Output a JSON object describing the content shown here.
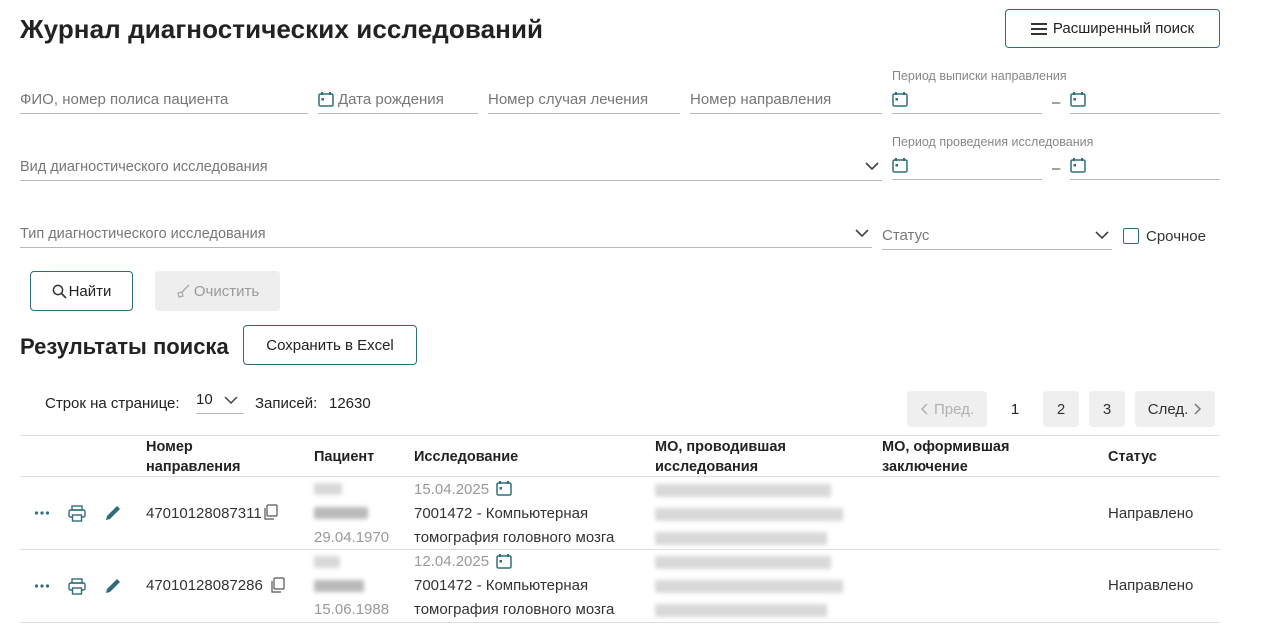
{
  "page": {
    "title": "Журнал диагностических исследований",
    "advanced_search_label": "Расширенный поиск"
  },
  "filters": {
    "fio_placeholder": "ФИО, номер полиса пациента",
    "birth_date_placeholder": "Дата рождения",
    "case_number_placeholder": "Номер случая лечения",
    "referral_number_placeholder": "Номер направления",
    "referral_period_label": "Период выписки направления",
    "study_period_label": "Период проведения исследования",
    "study_kind_placeholder": "Вид диагностического исследования",
    "study_type_placeholder": "Тип диагностического исследования",
    "status_placeholder": "Статус",
    "urgent_label": "Срочное",
    "range_dash": "–",
    "find_label": "Найти",
    "clear_label": "Очистить"
  },
  "results": {
    "title": "Результаты поиска",
    "excel_label": "Сохранить в Excel",
    "rows_per_page_label": "Строк на странице:",
    "rows_per_page_value": "10",
    "records_label": "Записей:",
    "records_count": "12630"
  },
  "pagination": {
    "prev_label": "Пред.",
    "next_label": "След.",
    "pages": [
      "1",
      "2",
      "3"
    ],
    "active_page": "1"
  },
  "table": {
    "headers": {
      "referral_number": "Номер направления",
      "patient": "Пациент",
      "study": "Исследование",
      "mo_conducted": "МО, проводившая исследования",
      "mo_conclusion": "МО, оформившая заключение",
      "status": "Статус"
    },
    "rows": [
      {
        "referral_number": "47010128087311",
        "patient_birth_date": "29.04.1970",
        "study_date": "15.04.2025",
        "study_line1": "7001472 - Компьютерная",
        "study_line2": "томография головного мозга",
        "status": "Направлено"
      },
      {
        "referral_number": "47010128087286",
        "patient_birth_date": "15.06.1988",
        "study_date": "12.04.2025",
        "study_line1": "7001472 - Компьютерная",
        "study_line2": "томография головного мозга",
        "status": "Направлено"
      }
    ]
  },
  "colors": {
    "accent": "#2e6e78",
    "text": "#222222",
    "muted": "#999999"
  }
}
